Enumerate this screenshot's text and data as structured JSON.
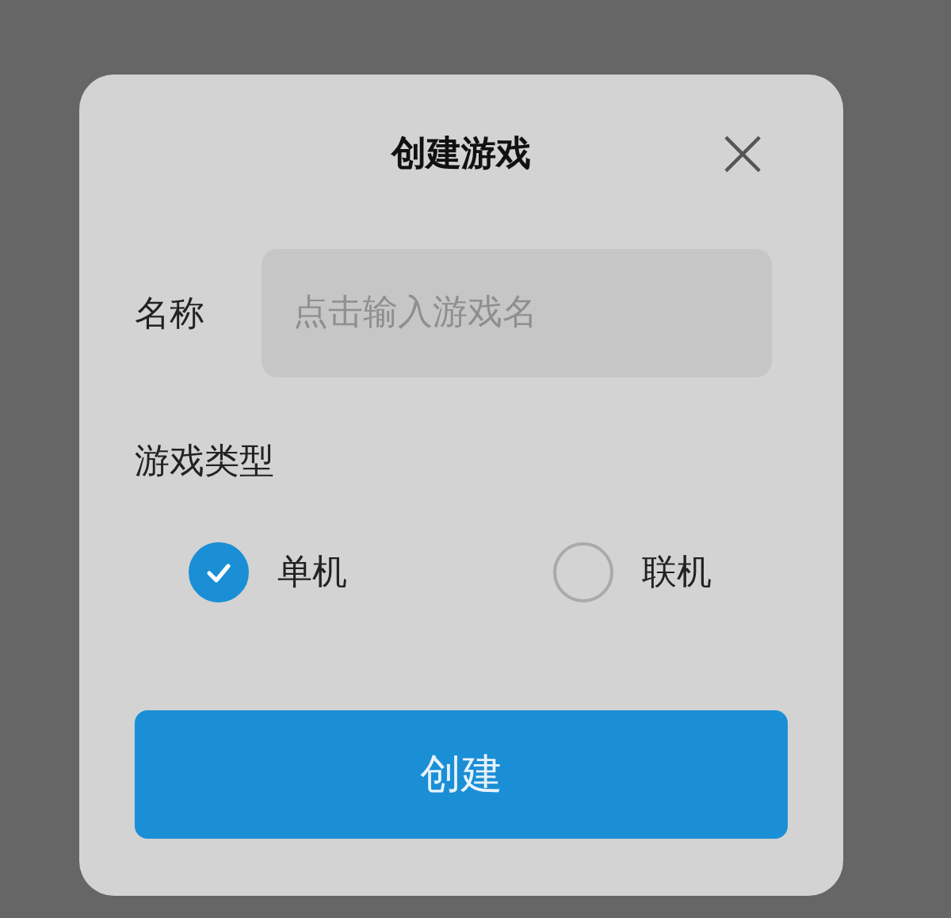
{
  "dialog": {
    "title": "创建游戏",
    "close": "×"
  },
  "name_field": {
    "label": "名称",
    "placeholder": "点击输入游戏名"
  },
  "game_type": {
    "label": "游戏类型",
    "options": [
      {
        "label": "单机",
        "selected": true
      },
      {
        "label": "联机",
        "selected": false
      }
    ]
  },
  "buttons": [
    "创建"
  ]
}
